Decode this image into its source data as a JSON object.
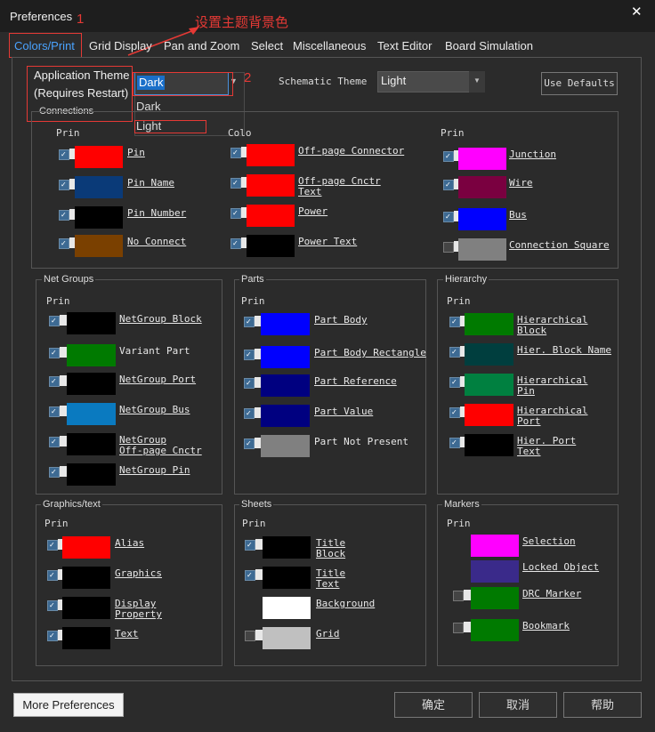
{
  "window": {
    "title": "Preferences",
    "close_glyph": "✕"
  },
  "tabs": [
    "Colors/Print",
    "Grid Display",
    "Pan and Zoom",
    "Select",
    "Miscellaneous",
    "Text Editor",
    "Board Simulation"
  ],
  "annotations": {
    "step1": "1",
    "step2": "2",
    "note": "设置主题背景色",
    "accent": "#e53935"
  },
  "top": {
    "app_theme_label_1": "Application Theme",
    "app_theme_label_2": "(Requires Restart)",
    "app_theme_value": "Dark",
    "app_theme_options": [
      "Dark",
      "Light"
    ],
    "connections_title": "Connections",
    "schematic_theme_label": "Schematic Theme",
    "schematic_theme_value": "Light",
    "use_defaults": "Use Defaults"
  },
  "sections": {
    "conn_col1": {
      "header": "Prin",
      "items": [
        {
          "label": "Pin",
          "color": "#ff0000",
          "checked": true
        },
        {
          "label": "Pin Name",
          "color": "#0a3a78",
          "checked": true
        },
        {
          "label": "Pin Number",
          "color": "#000000",
          "checked": true
        },
        {
          "label": "No Connect",
          "color": "#7a4000",
          "checked": true
        }
      ]
    },
    "conn_col2": {
      "header": "Colo",
      "items": [
        {
          "label": "Off-page Connector",
          "color": "#ff0000",
          "checked": true
        },
        {
          "label": "Off-page Cnctr\nText",
          "color": "#ff0000",
          "checked": true
        },
        {
          "label": "Power",
          "color": "#ff0000",
          "checked": true
        },
        {
          "label": "Power Text",
          "color": "#000000",
          "checked": true
        }
      ]
    },
    "conn_col3": {
      "header": "Prin",
      "items": [
        {
          "label": "Junction",
          "color": "#ff00ff",
          "checked": true
        },
        {
          "label": "Wire",
          "color": "#7a0040",
          "checked": true
        },
        {
          "label": "Bus",
          "color": "#0000ff",
          "checked": true
        },
        {
          "label": "Connection Square",
          "color": "#808080",
          "checked": false
        }
      ]
    },
    "net_groups": {
      "title": "Net Groups",
      "header": "Prin",
      "items": [
        {
          "label": "NetGroup Block",
          "color": "#000000",
          "checked": true
        },
        {
          "label": "Variant Part",
          "color": "#007a00",
          "checked": true,
          "plain": true
        },
        {
          "label": "NetGroup Port",
          "color": "#000000",
          "checked": true
        },
        {
          "label": "NetGroup Bus",
          "color": "#0a7ac0",
          "checked": true
        },
        {
          "label": "NetGroup\nOff-page Cnctr",
          "color": "#000000",
          "checked": true
        },
        {
          "label": "NetGroup Pin",
          "color": "#000000",
          "checked": true
        }
      ]
    },
    "parts": {
      "title": "Parts",
      "header": "Prin",
      "items": [
        {
          "label": "Part Body",
          "color": "#0000ff",
          "checked": true
        },
        {
          "label": "Part Body Rectangle",
          "color": "#0000ff",
          "checked": true
        },
        {
          "label": "Part Reference",
          "color": "#000080",
          "checked": true
        },
        {
          "label": "Part Value",
          "color": "#000080",
          "checked": true
        },
        {
          "label": "Part Not Present",
          "color": "#808080",
          "checked": true,
          "plain": true
        }
      ]
    },
    "hierarchy": {
      "title": "Hierarchy",
      "header": "Prin",
      "items": [
        {
          "label": "Hierarchical\nBlock",
          "color": "#007a00",
          "checked": true
        },
        {
          "label": "Hier. Block Name",
          "color": "#003e3e",
          "checked": true
        },
        {
          "label": "Hierarchical\nPin",
          "color": "#008040",
          "checked": true
        },
        {
          "label": "Hierarchical\nPort",
          "color": "#ff0000",
          "checked": true
        },
        {
          "label": "Hier. Port\nText",
          "color": "#000000",
          "checked": true
        }
      ]
    },
    "graphics": {
      "title": "Graphics/text",
      "header": "Prin",
      "items": [
        {
          "label": "Alias",
          "color": "#ff0000",
          "checked": true
        },
        {
          "label": "Graphics",
          "color": "#000000",
          "checked": true
        },
        {
          "label": "Display\nProperty",
          "color": "#000000",
          "checked": true
        },
        {
          "label": "Text",
          "color": "#000000",
          "checked": true
        }
      ]
    },
    "sheets": {
      "title": "Sheets",
      "header": "Prin",
      "items": [
        {
          "label": "Title\nBlock",
          "color": "#000000",
          "checked": true
        },
        {
          "label": "Title\nText",
          "color": "#000000",
          "checked": true
        },
        {
          "label": "Background",
          "color": "#ffffff",
          "checked": null
        },
        {
          "label": "Grid",
          "color": "#c0c0c0",
          "checked": false
        }
      ]
    },
    "markers": {
      "title": "Markers",
      "header": "Prin",
      "items": [
        {
          "label": "Selection",
          "color": "#ff00ff",
          "checked": null
        },
        {
          "label": "Locked Object",
          "color": "#3a2a8a",
          "checked": null
        },
        {
          "label": "DRC Marker",
          "color": "#007a00",
          "checked": false
        },
        {
          "label": "Bookmark",
          "color": "#007a00",
          "checked": false
        }
      ]
    }
  },
  "footer": {
    "more_preferences": "More Preferences",
    "ok": "确定",
    "cancel": "取消",
    "help": "帮助"
  }
}
